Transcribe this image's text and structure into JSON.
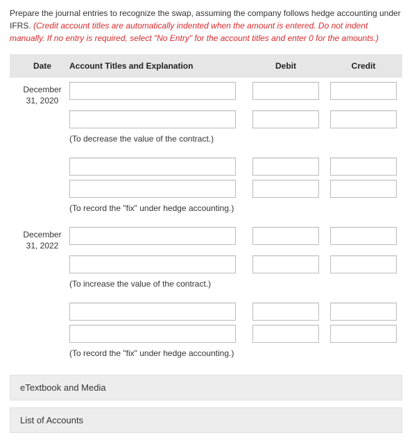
{
  "instructions": {
    "lead": "Prepare the journal entries to recognize the swap, assuming the company follows hedge accounting under IFRS. ",
    "note": "(Credit account titles are automatically indented when the amount is entered. Do not indent manually. If no entry is required, select \"No Entry\" for the account titles and enter 0 for the amounts.)"
  },
  "headers": {
    "date": "Date",
    "account": "Account Titles and Explanation",
    "debit": "Debit",
    "credit": "Credit"
  },
  "groups": [
    {
      "date_lines": [
        "December",
        "31, 2020"
      ],
      "rows": [
        {},
        {}
      ],
      "explanation": "(To decrease the value of the contract.)"
    },
    {
      "date_lines": [
        "",
        ""
      ],
      "rows": [
        {},
        {}
      ],
      "explanation": "(To record the \"fix\" under hedge accounting.)"
    },
    {
      "date_lines": [
        "December",
        "31, 2022"
      ],
      "rows": [
        {},
        {}
      ],
      "explanation": "(To increase the value of the contract.)"
    },
    {
      "date_lines": [
        "",
        ""
      ],
      "rows": [
        {},
        {}
      ],
      "explanation": "(To record the \"fix\" under hedge accounting.)"
    }
  ],
  "links": {
    "etextbook": "eTextbook and Media",
    "accounts": "List of Accounts"
  }
}
